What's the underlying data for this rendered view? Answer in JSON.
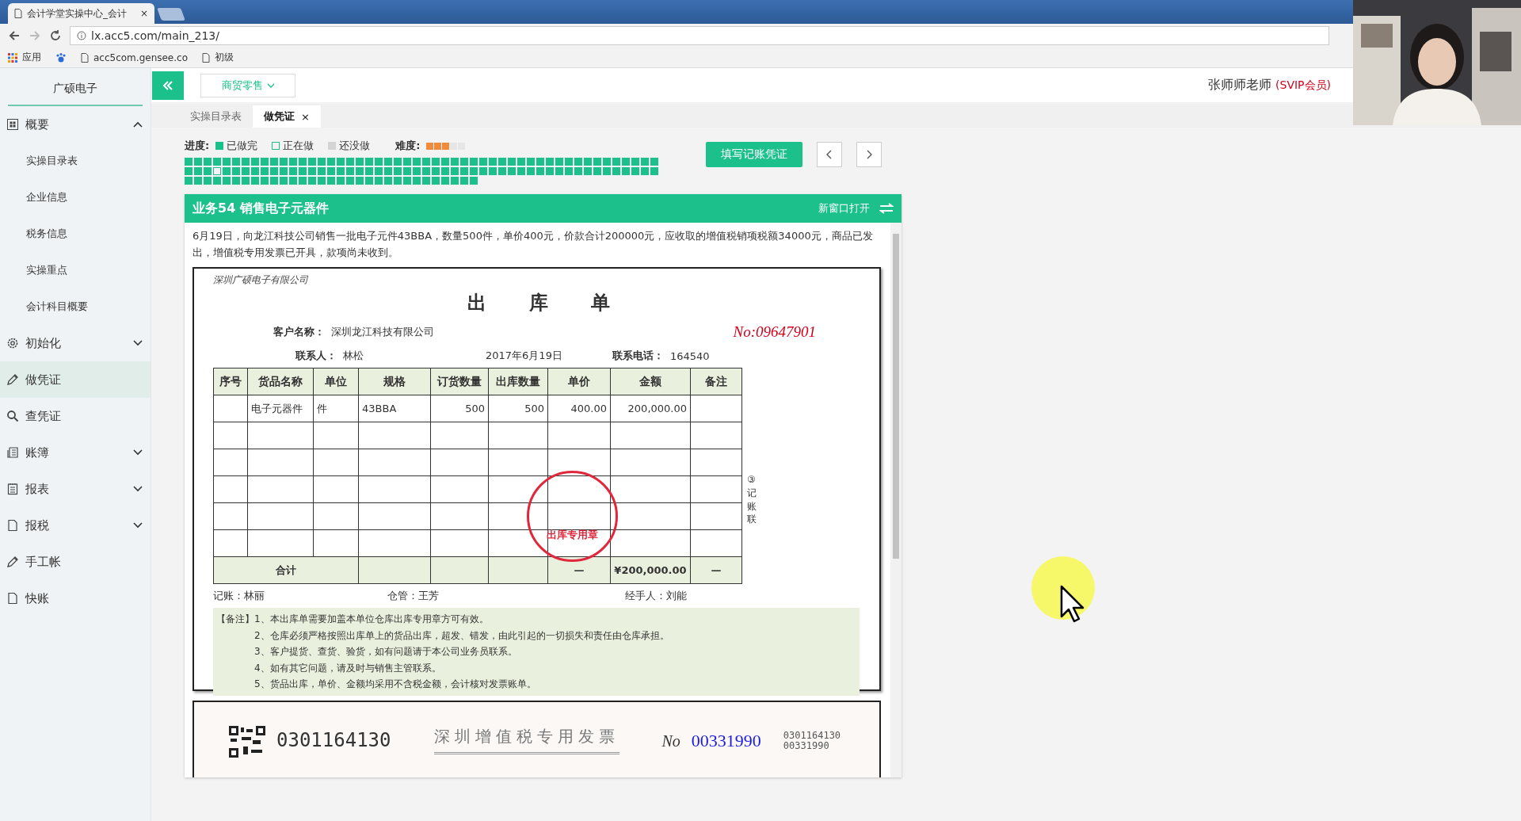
{
  "browser": {
    "tab_title": "会计学堂实操中心_会计",
    "close": "×",
    "url": "lx.acc5.com/main_213/",
    "bookmarks": [
      "应用",
      "acc5com.gensee.co",
      "初级"
    ]
  },
  "header": {
    "industry": "商贸零售",
    "user": "张师师老师",
    "membership": "(SVIP会员)"
  },
  "sidebar": {
    "company": "广硕电子",
    "items": [
      {
        "label": "概要",
        "expanded": true,
        "selected": false,
        "children": [
          {
            "label": "实操目录表",
            "selected": false
          },
          {
            "label": "企业信息",
            "selected": false
          },
          {
            "label": "税务信息",
            "selected": false
          },
          {
            "label": "实操重点",
            "selected": false
          },
          {
            "label": "会计科目概要",
            "selected": false
          }
        ]
      },
      {
        "label": "初始化",
        "expanded": false,
        "selected": false
      },
      {
        "label": "做凭证",
        "selected": true
      },
      {
        "label": "查凭证",
        "selected": false
      },
      {
        "label": "账簿",
        "expanded": false,
        "selected": false
      },
      {
        "label": "报表",
        "expanded": false,
        "selected": false
      },
      {
        "label": "报税",
        "expanded": false,
        "selected": false
      },
      {
        "label": "手工帐",
        "selected": false
      },
      {
        "label": "快账",
        "selected": false
      }
    ]
  },
  "tabs": [
    {
      "label": "实操目录表",
      "selected": false
    },
    {
      "label": "做凭证",
      "selected": true,
      "close": "×"
    }
  ],
  "progress": {
    "label": "进度:",
    "legend": [
      {
        "label": "已做完",
        "kind": "done"
      },
      {
        "label": "正在做",
        "kind": "current"
      },
      {
        "label": "还没做",
        "kind": "todo"
      }
    ],
    "difficulty_label": "难度:",
    "stars": 3,
    "cells": [
      {
        "current": false
      },
      {
        "current": false
      },
      {
        "current": false
      },
      {
        "current": false
      },
      {
        "current": false
      },
      {
        "current": false
      },
      {
        "current": false
      },
      {
        "current": false
      },
      {
        "current": false
      },
      {
        "current": false
      },
      {
        "current": false
      },
      {
        "current": false
      },
      {
        "current": false
      },
      {
        "current": false
      },
      {
        "current": false
      },
      {
        "current": false
      },
      {
        "current": false
      },
      {
        "current": false
      },
      {
        "current": false
      },
      {
        "current": false
      },
      {
        "current": false
      },
      {
        "current": false
      },
      {
        "current": false
      },
      {
        "current": false
      },
      {
        "current": false
      },
      {
        "current": false
      },
      {
        "current": false
      },
      {
        "current": false
      },
      {
        "current": false
      },
      {
        "current": false
      },
      {
        "current": false
      },
      {
        "current": false
      },
      {
        "current": false
      },
      {
        "current": false
      },
      {
        "current": false
      },
      {
        "current": false
      },
      {
        "current": false
      },
      {
        "current": false
      },
      {
        "current": false
      },
      {
        "current": false
      },
      {
        "current": false
      },
      {
        "current": false
      },
      {
        "current": false
      },
      {
        "current": false
      },
      {
        "current": false
      },
      {
        "current": false
      },
      {
        "current": false
      },
      {
        "current": false
      },
      {
        "current": false
      },
      {
        "current": false
      },
      {
        "current": false
      },
      {
        "current": false
      },
      {
        "current": false
      },
      {
        "current": true
      },
      {
        "current": false
      },
      {
        "current": false
      },
      {
        "current": false
      },
      {
        "current": false
      },
      {
        "current": false
      },
      {
        "current": false
      },
      {
        "current": false
      },
      {
        "current": false
      },
      {
        "current": false
      },
      {
        "current": false
      },
      {
        "current": false
      },
      {
        "current": false
      },
      {
        "current": false
      },
      {
        "current": false
      },
      {
        "current": false
      },
      {
        "current": false
      },
      {
        "current": false
      },
      {
        "current": false
      },
      {
        "current": false
      },
      {
        "current": false
      },
      {
        "current": false
      },
      {
        "current": false
      },
      {
        "current": false
      },
      {
        "current": false
      },
      {
        "current": false
      },
      {
        "current": false
      },
      {
        "current": false
      },
      {
        "current": false
      },
      {
        "current": false
      },
      {
        "current": false
      },
      {
        "current": false
      },
      {
        "current": false
      },
      {
        "current": false
      },
      {
        "current": false
      },
      {
        "current": false
      },
      {
        "current": false
      },
      {
        "current": false
      },
      {
        "current": false
      },
      {
        "current": false
      },
      {
        "current": false
      },
      {
        "current": false
      },
      {
        "current": false
      },
      {
        "current": false
      },
      {
        "current": false
      },
      {
        "current": false
      },
      {
        "current": false
      },
      {
        "current": false
      },
      {
        "current": false
      },
      {
        "current": false
      },
      {
        "current": false
      },
      {
        "current": false
      },
      {
        "current": false
      },
      {
        "current": false
      },
      {
        "current": false
      },
      {
        "current": false
      },
      {
        "current": false
      },
      {
        "current": false
      },
      {
        "current": false
      },
      {
        "current": false
      },
      {
        "current": false
      },
      {
        "current": false
      },
      {
        "current": false
      },
      {
        "current": false
      },
      {
        "current": false
      },
      {
        "current": false
      },
      {
        "current": false
      },
      {
        "current": false
      },
      {
        "current": false
      },
      {
        "current": false
      },
      {
        "current": false
      },
      {
        "current": false
      },
      {
        "current": false
      },
      {
        "current": false
      },
      {
        "current": false
      },
      {
        "current": false
      },
      {
        "current": false
      },
      {
        "current": false
      }
    ]
  },
  "fill_button": "填写记账凭证",
  "task": {
    "title": "业务54 销售电子元器件",
    "open_new_window": "新窗口打开",
    "description": "6月19日，向龙江科技公司销售一批电子元件43BBA，数量500件，单价400元，价款合计200000元，应收取的增值税销项税额34000元，商品已发出，增值税专用发票已开具，款项尚未收到。"
  },
  "delivery_note": {
    "company": "深圳广硕电子有限公司",
    "title": "出库单",
    "customer_label": "客户名称：",
    "customer": "深圳龙江科技有限公司",
    "number": "No:09647901",
    "contact_label": "联系人：",
    "contact": "林松",
    "date": "2017年6月19日",
    "phone_label": "联系电话：",
    "phone": "164540",
    "columns": [
      "序号",
      "货品名称",
      "单位",
      "规格",
      "订货数量",
      "出库数量",
      "单价",
      "金额",
      "备注"
    ],
    "rows": [
      {
        "item": "电子元器件",
        "unit": "件",
        "spec": "43BBA",
        "ordered": "500",
        "shipped": "500",
        "price": "400.00",
        "amount": "200,000.00"
      }
    ],
    "total": {
      "label": "合计",
      "price": "—",
      "amount": "¥200,000.00",
      "note": "—"
    },
    "copy_label": "③记账联",
    "signatures": [
      "记账：林丽",
      "仓管：王芳",
      "经手人：刘能"
    ],
    "notes_label": "【备注】",
    "notes": [
      "1、本出库单需要加盖本单位仓库出库专用章方可有效。",
      "2、仓库必须严格按照出库单上的货品出库，超发、错发，由此引起的一切损失和责任由仓库承担。",
      "3、客户提货、查货、验货，如有问题请于本公司业务员联系。",
      "4、如有其它问题，请及时与销售主管联系。",
      "5、货品出库，单价、金额均采用不含税金额，会计核对发票账单。"
    ],
    "stamp": "出库专用章"
  },
  "invoice": {
    "code": "0301164130",
    "title": "深圳增值税专用发票",
    "no_mark": "No",
    "number": "00331990",
    "code_small": "0301164130",
    "number_small": "00331990"
  }
}
